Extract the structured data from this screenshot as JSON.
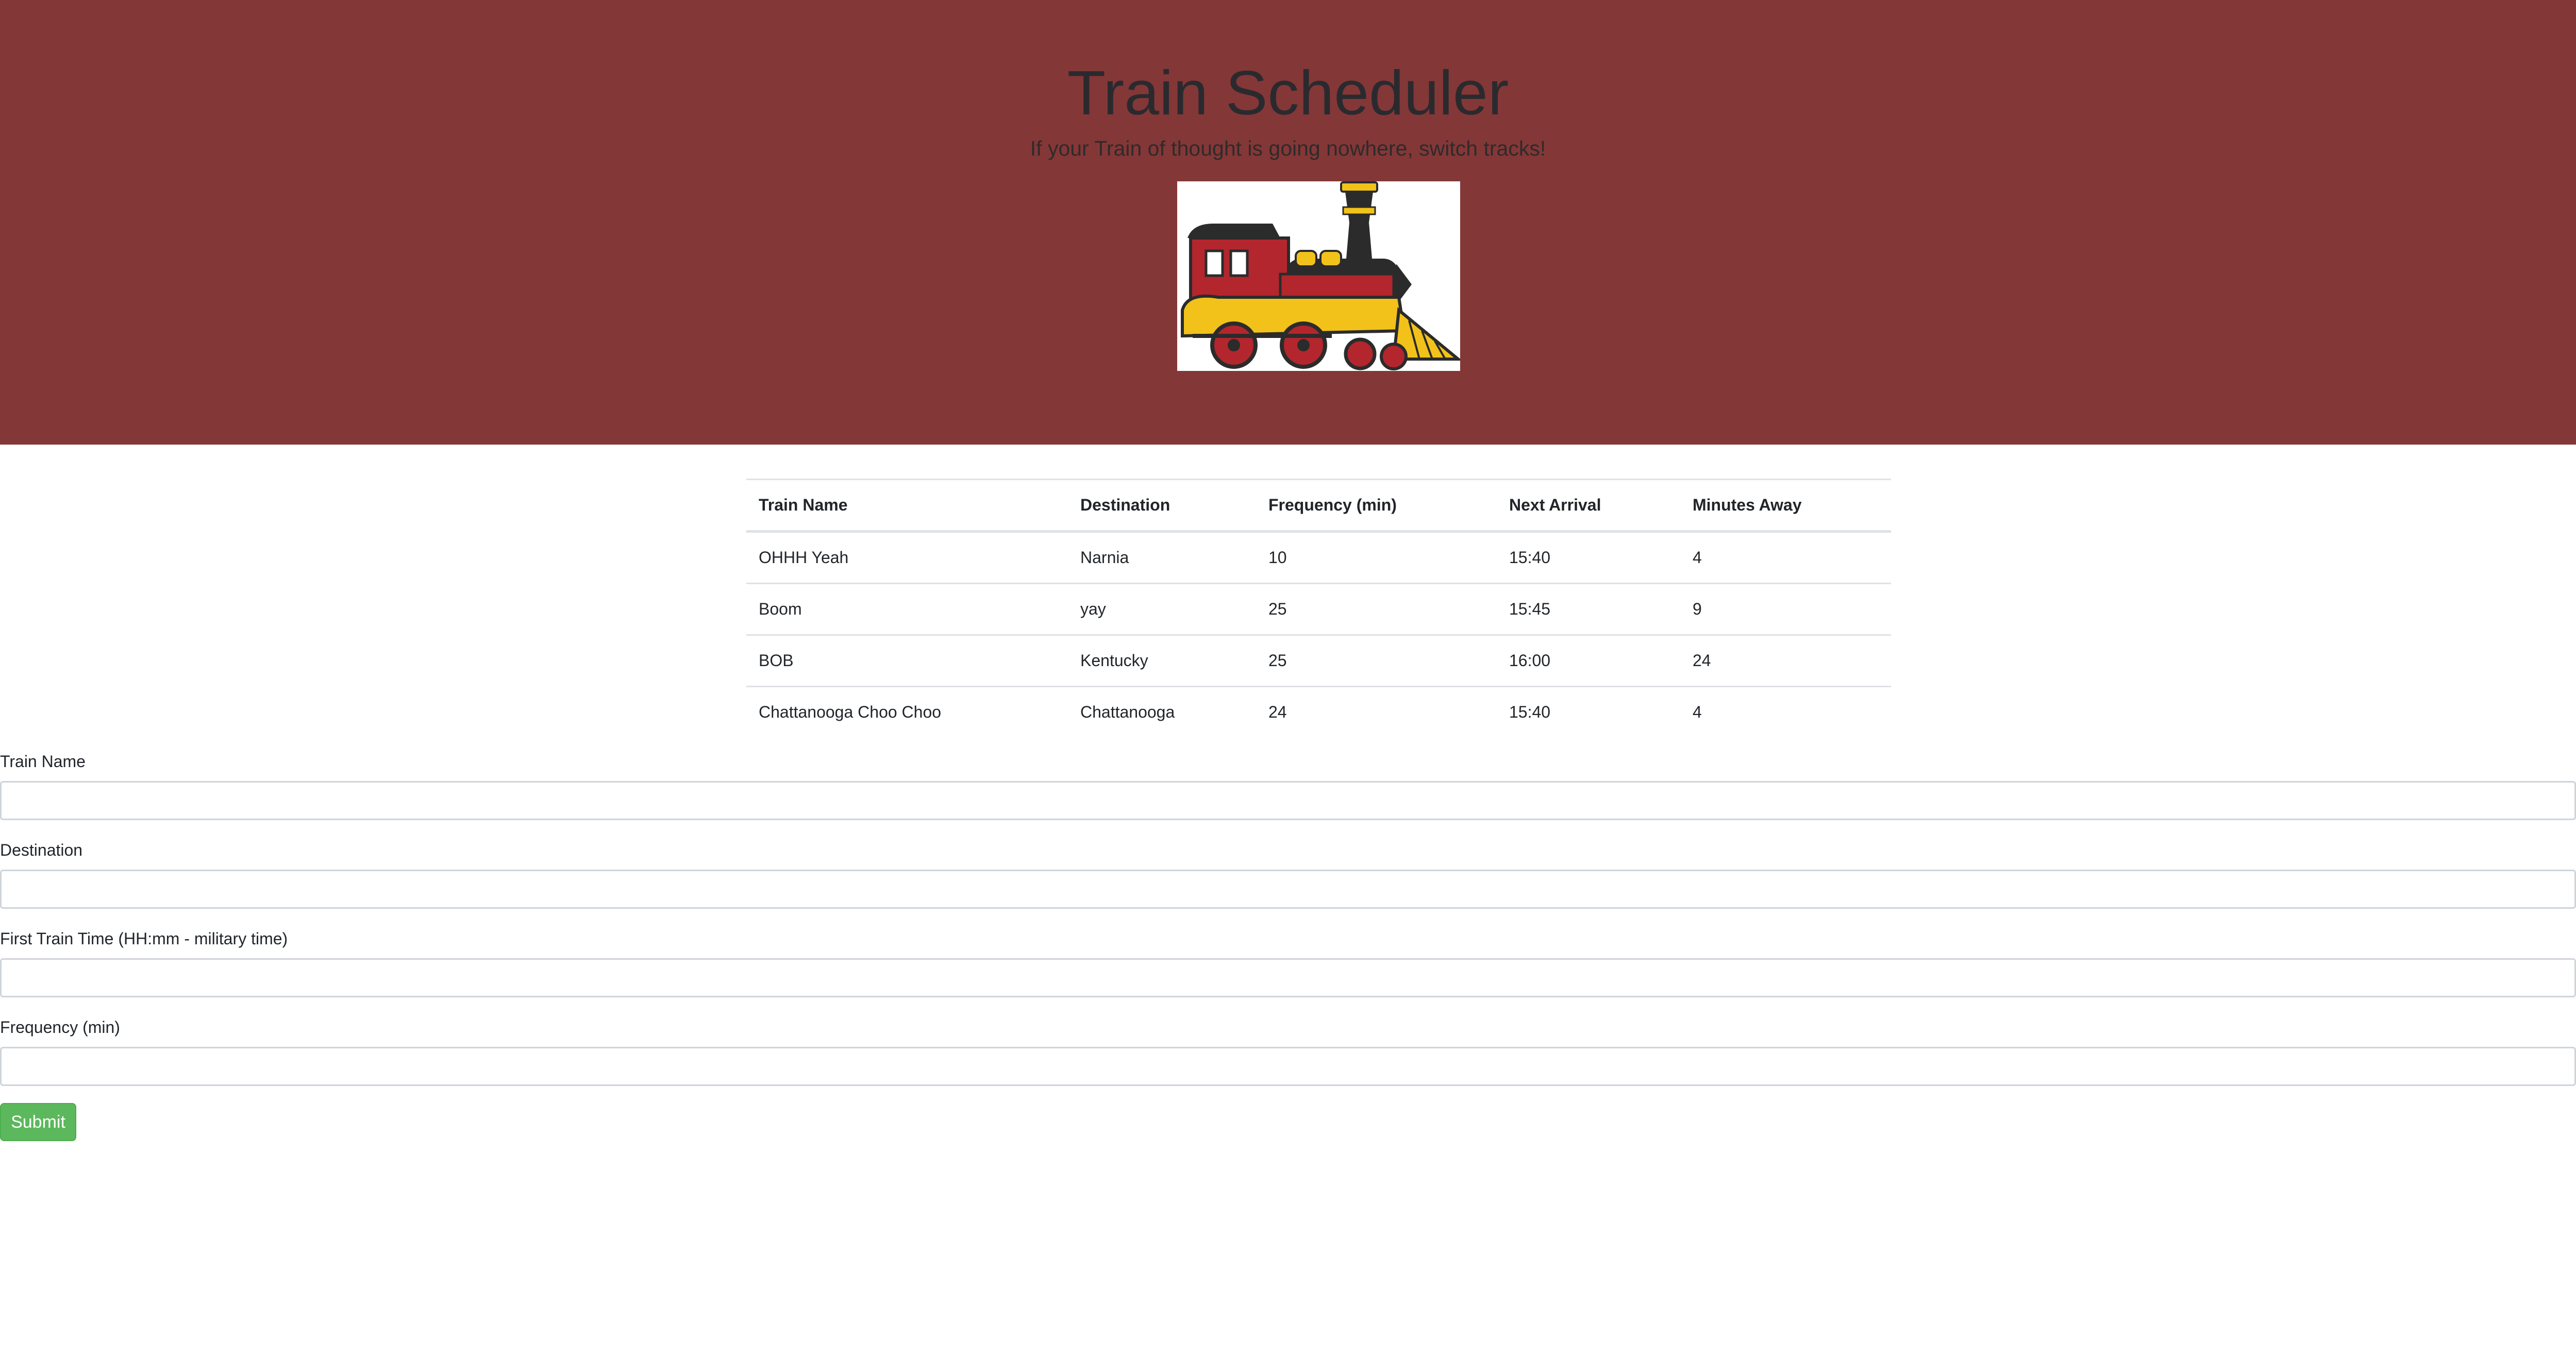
{
  "header": {
    "title": "Train Scheduler",
    "subtitle": "If your Train of thought is going nowhere, switch tracks!",
    "image_icon": "steam-locomotive-illustration"
  },
  "schedule_table": {
    "columns": [
      "Train Name",
      "Destination",
      "Frequency (min)",
      "Next Arrival",
      "Minutes Away"
    ],
    "rows": [
      [
        "OHHH Yeah",
        "Narnia",
        "10",
        "15:40",
        "4"
      ],
      [
        "Boom",
        "yay",
        "25",
        "15:45",
        "9"
      ],
      [
        "BOB",
        "Kentucky",
        "25",
        "16:00",
        "24"
      ],
      [
        "Chattanooga Choo Choo",
        "Chattanooga",
        "24",
        "15:40",
        "4"
      ]
    ]
  },
  "form": {
    "fields": [
      {
        "label": "Train Name",
        "value": "",
        "placeholder": ""
      },
      {
        "label": "Destination",
        "value": "",
        "placeholder": ""
      },
      {
        "label": "First Train Time (HH:mm - military time)",
        "value": "",
        "placeholder": ""
      },
      {
        "label": "Frequency (min)",
        "value": "",
        "placeholder": ""
      }
    ],
    "submit_label": "Submit"
  },
  "colors": {
    "header_bg": "#843737",
    "submit_bg": "#5cb85c",
    "train_red": "#b3262d",
    "train_yellow": "#f2c21b",
    "train_black": "#2b2b2b"
  }
}
